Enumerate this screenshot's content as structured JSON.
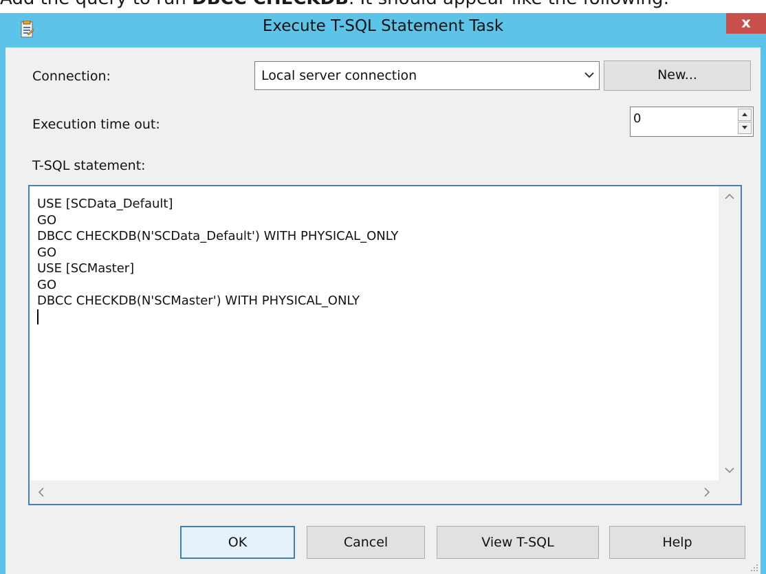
{
  "caption": {
    "prefix": "Add the query to run ",
    "bold": "DBCC CHECKDB",
    "suffix": ". It should appear like the following:"
  },
  "dialog": {
    "title": "Execute T-SQL Statement Task",
    "close_label": "x",
    "icon": "task-icon"
  },
  "form": {
    "connection_label": "Connection:",
    "connection_value": "Local server connection",
    "new_button": "New...",
    "timeout_label": "Execution time out:",
    "timeout_value": "0",
    "statement_label": "T-SQL statement:"
  },
  "statement_lines": [
    "USE [SCData_Default]",
    "GO",
    "DBCC CHECKDB(N'SCData_Default') WITH PHYSICAL_ONLY",
    "GO",
    "USE [SCMaster]",
    "GO",
    "DBCC CHECKDB(N'SCMaster') WITH PHYSICAL_ONLY"
  ],
  "buttons": {
    "ok": "OK",
    "cancel": "Cancel",
    "view_tsql": "View T-SQL",
    "help": "Help"
  },
  "colors": {
    "titlebar": "#5bc4e8",
    "close": "#c7504a",
    "editor_border": "#4a7cbf"
  }
}
